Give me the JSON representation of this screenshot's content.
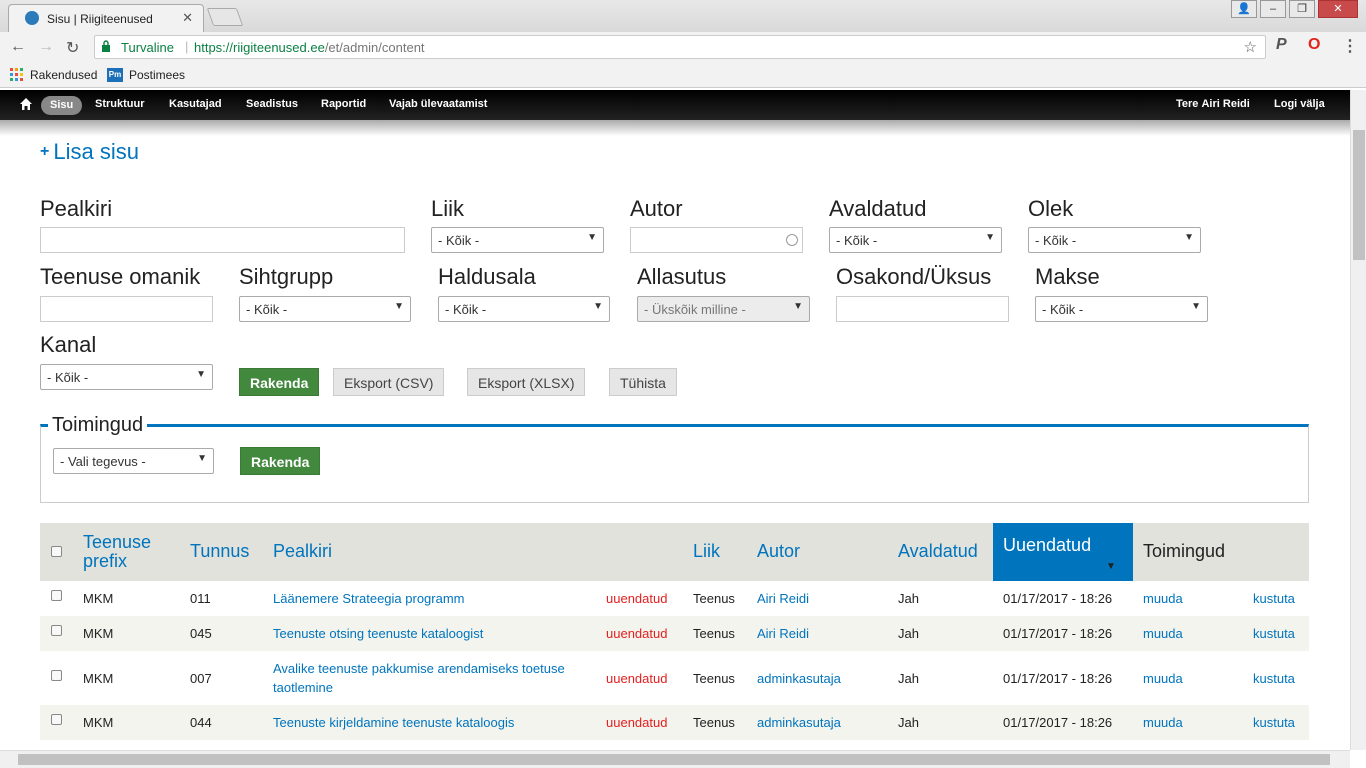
{
  "browser": {
    "tab_title": "Sisu | Riigiteenused",
    "secure_label": "Turvaline",
    "url_host": "https://riigiteenused.ee",
    "url_path": "/et/admin/content",
    "bookmarks": [
      "Rakendused",
      "Postimees"
    ]
  },
  "toolbar": {
    "items": [
      "Sisu",
      "Struktuur",
      "Kasutajad",
      "Seadistus",
      "Raportid",
      "Vajab ülevaatamist"
    ],
    "greeting": "Tere",
    "user": "Airi Reidi",
    "logout": "Logi välja"
  },
  "add_content": "Lisa sisu",
  "filters": {
    "pealkiri": "Pealkiri",
    "liik": "Liik",
    "liik_value": "- Kõik -",
    "autor": "Autor",
    "avaldatud": "Avaldatud",
    "avaldatud_value": "- Kõik -",
    "olek": "Olek",
    "olek_value": "- Kõik -",
    "omanik": "Teenuse omanik",
    "sihtgrupp": "Sihtgrupp",
    "sihtgrupp_value": "- Kõik -",
    "haldusala": "Haldusala",
    "haldusala_value": "- Kõik -",
    "allasutus": "Allasutus",
    "allasutus_value": "- Ükskõik milline -",
    "osakond": "Osakond/Üksus",
    "makse": "Makse",
    "makse_value": "- Kõik -",
    "kanal": "Kanal",
    "kanal_value": "- Kõik -"
  },
  "buttons": {
    "apply": "Rakenda",
    "export_csv": "Eksport (CSV)",
    "export_xlsx": "Eksport (XLSX)",
    "reset": "Tühista"
  },
  "actions": {
    "legend": "Toimingud",
    "select_value": "- Vali tegevus -",
    "apply": "Rakenda"
  },
  "table": {
    "headers": {
      "prefix": "Teenuse prefix",
      "tunnus": "Tunnus",
      "pealkiri": "Pealkiri",
      "liik": "Liik",
      "autor": "Autor",
      "avaldatud": "Avaldatud",
      "uuendatud": "Uuendatud",
      "toimingud": "Toimingud"
    },
    "rows": [
      {
        "prefix": "MKM",
        "tunnus": "011",
        "title": "Läänemere Strateegia programm",
        "status": "uuendatud",
        "type": "Teenus",
        "author": "Airi Reidi",
        "published": "Jah",
        "updated": "01/17/2017 - 18:26",
        "edit": "muuda",
        "delete": "kustuta"
      },
      {
        "prefix": "MKM",
        "tunnus": "045",
        "title": "Teenuste otsing teenuste kataloogist",
        "status": "uuendatud",
        "type": "Teenus",
        "author": "Airi Reidi",
        "published": "Jah",
        "updated": "01/17/2017 - 18:26",
        "edit": "muuda",
        "delete": "kustuta"
      },
      {
        "prefix": "MKM",
        "tunnus": "007",
        "title": "Avalike teenuste pakkumise arendamiseks toetuse",
        "title2": "taotlemine",
        "status": "uuendatud",
        "type": "Teenus",
        "author": "adminkasutaja",
        "published": "Jah",
        "updated": "01/17/2017 - 18:26",
        "edit": "muuda",
        "delete": "kustuta"
      },
      {
        "prefix": "MKM",
        "tunnus": "044",
        "title": "Teenuste kirjeldamine teenuste kataloogis",
        "status": "uuendatud",
        "type": "Teenus",
        "author": "adminkasutaja",
        "published": "Jah",
        "updated": "01/17/2017 - 18:26",
        "edit": "muuda",
        "delete": "kustuta"
      }
    ]
  }
}
